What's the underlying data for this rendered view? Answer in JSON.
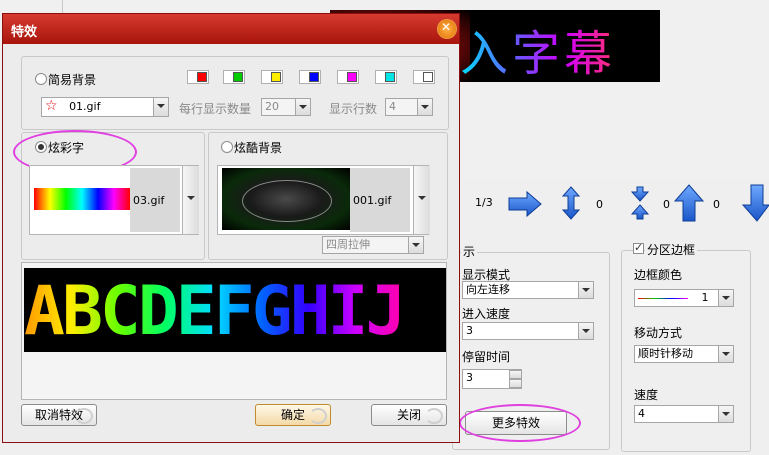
{
  "background": {
    "banner_text": "入字幕",
    "page_indicator": "1/3",
    "arrows": [
      {
        "icon": "arrow-right-icon",
        "count": ""
      },
      {
        "icon": "arrow-updown-icon",
        "count": "0"
      },
      {
        "icon": "arrow-converge-icon",
        "count": "0"
      },
      {
        "icon": "arrow-up-icon",
        "count": "0"
      },
      {
        "icon": "arrow-down-icon",
        "count": ""
      }
    ],
    "display": {
      "legend": "示",
      "mode_label": "显示模式",
      "mode_value": "向左连移",
      "speed_label": "进入速度",
      "speed_value": "3",
      "stay_label": "停留时间",
      "stay_value": "3",
      "more_effects": "更多特效"
    },
    "border": {
      "legend": "分区边框",
      "color_label": "边框颜色",
      "color_value": "1",
      "move_label": "移动方式",
      "move_value": "顺时针移动",
      "speed_label": "速度",
      "speed_value": "4"
    }
  },
  "dialog": {
    "title": "特效",
    "simple_bg": {
      "label": "简易背景",
      "file": "01.gif",
      "per_row_label": "每行显示数量",
      "per_row_value": "20",
      "rows_label": "显示行数",
      "rows_value": "4",
      "swatch_colors": [
        "#ff0000",
        "#00cc00",
        "#ffee00",
        "#0000ff",
        "#ff00ff",
        "#00e5e5",
        "#ffffff"
      ]
    },
    "colorful_text": {
      "label": "炫彩字",
      "file": "03.gif"
    },
    "cool_bg": {
      "label": "炫酷背景",
      "file": "001.gif",
      "stretch_value": "四周拉伸"
    },
    "preview_text": "ABCDEFGHIJ",
    "buttons": {
      "cancel": "取消特效",
      "ok": "确定",
      "close": "关闭"
    }
  }
}
